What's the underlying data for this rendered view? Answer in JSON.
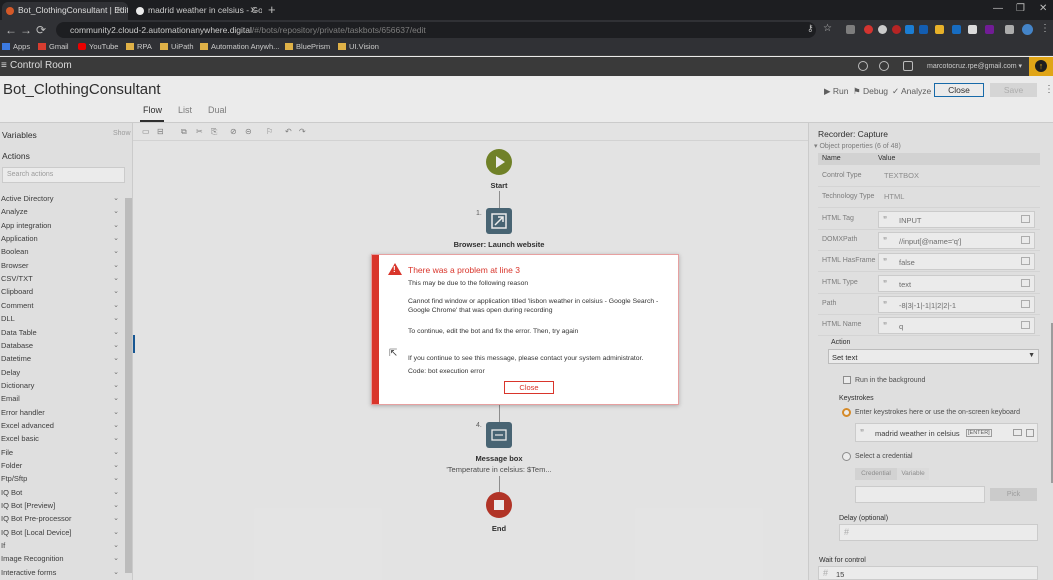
{
  "browser": {
    "tabs": [
      {
        "title": "Bot_ClothingConsultant | Edit Ta...",
        "active": true
      },
      {
        "title": "madrid weather in celsius - Goog...",
        "active": false
      }
    ],
    "url_host": "community2.cloud-2.automationanywhere.digital",
    "url_path": "/#/bots/repository/private/taskbots/656637/edit",
    "bookmarks": [
      "Apps",
      "Gmail",
      "YouTube",
      "RPA",
      "UiPath",
      "Automation Anywh...",
      "BluePrism",
      "UI.Vision"
    ]
  },
  "control_room": {
    "title": "Control Room",
    "user_email": "marcotocruz.rpe@gmail.com"
  },
  "editor": {
    "bot_name": "Bot_ClothingConsultant",
    "view_tabs": [
      "Flow",
      "List",
      "Dual"
    ],
    "actions": {
      "run": "Run",
      "debug": "Debug",
      "analyze": "Analyze",
      "close": "Close",
      "save": "Save"
    }
  },
  "left_panel": {
    "variables_label": "Variables",
    "show_label": "Show",
    "actions_label": "Actions",
    "search_placeholder": "Search actions",
    "action_items": [
      "Active Directory",
      "Analyze",
      "App integration",
      "Application",
      "Boolean",
      "Browser",
      "CSV/TXT",
      "Clipboard",
      "Comment",
      "DLL",
      "Data Table",
      "Database",
      "Datetime",
      "Delay",
      "Dictionary",
      "Email",
      "Error handler",
      "Excel advanced",
      "Excel basic",
      "File",
      "Folder",
      "Ftp/Sftp",
      "IQ Bot",
      "IQ Bot [Preview]",
      "IQ Bot Pre-processor",
      "IQ Bot [Local Device]",
      "If",
      "Image Recognition",
      "Interactive forms"
    ]
  },
  "flow": {
    "start_label": "Start",
    "step1_num": "1.",
    "step1_label": "Browser: Launch website",
    "step4_num": "4.",
    "step4_label": "Message box",
    "step4_sub": "'Temperature in celsius: $Tem...",
    "end_label": "End"
  },
  "dialog": {
    "title": "There was a problem at line 3",
    "line1": "This may be due to the following reason",
    "line2": "Cannot find window or application titled 'lisbon weather in celsius - Google Search - Google Chrome' that was open during recording",
    "line3": "To continue, edit the bot and fix the error. Then, try again",
    "line4": "If you continue to see this message, please contact your system administrator.",
    "code_label": "Code:",
    "code_value": "bot execution error",
    "close_label": "Close"
  },
  "right_panel": {
    "title": "Recorder: Capture",
    "subtitle": "Object properties (6 of 48)",
    "col_name": "Name",
    "col_value": "Value",
    "properties": [
      {
        "name": "Control Type",
        "value": "TEXTBOX",
        "editable": false
      },
      {
        "name": "Technology Type",
        "value": "HTML",
        "editable": false
      },
      {
        "name": "HTML Tag",
        "value": "INPUT",
        "editable": true
      },
      {
        "name": "DOMXPath",
        "value": "//input[@name='q']",
        "editable": true
      },
      {
        "name": "HTML HasFrame",
        "value": "false",
        "editable": true
      },
      {
        "name": "HTML Type",
        "value": "text",
        "editable": true
      },
      {
        "name": "Path",
        "value": "-8|3|-1|-1|1|2|2|-1",
        "editable": true
      },
      {
        "name": "HTML Name",
        "value": "q",
        "editable": true
      }
    ],
    "action_label": "Action",
    "action_value": "Set text",
    "run_bg_label": "Run in the background",
    "keystrokes_label": "Keystrokes",
    "keystrokes_option": "Enter keystrokes here or use the on-screen keyboard",
    "keystrokes_value": "madrid weather in celsius",
    "enter_tag": "[ENTER]",
    "credential_option": "Select a credential",
    "credential_tab": "Credential",
    "variable_tab": "Variable",
    "pick_label": "Pick",
    "delay_label": "Delay (optional)",
    "wait_label": "Wait for control",
    "wait_value": "15"
  }
}
